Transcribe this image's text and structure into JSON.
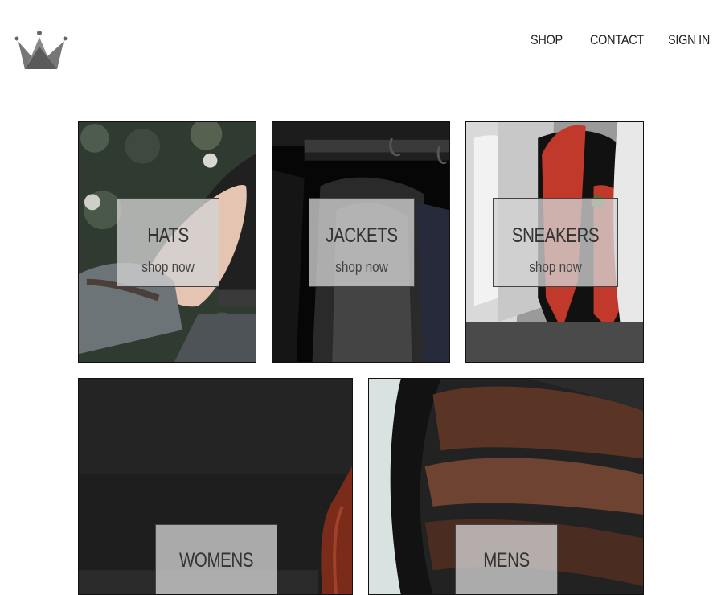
{
  "nav": {
    "logo_icon": "crown-icon",
    "links": [
      "SHOP",
      "CONTACT",
      "SIGN IN"
    ]
  },
  "categories": [
    {
      "title": "HATS",
      "subtitle": "shop now"
    },
    {
      "title": "JACKETS",
      "subtitle": "shop now"
    },
    {
      "title": "SNEAKERS",
      "subtitle": "shop now"
    },
    {
      "title": "WOMENS"
    },
    {
      "title": "MENS"
    }
  ],
  "colors": {
    "text": "#222222",
    "card_border": "#111111",
    "label_background": "#d2d2d2"
  }
}
